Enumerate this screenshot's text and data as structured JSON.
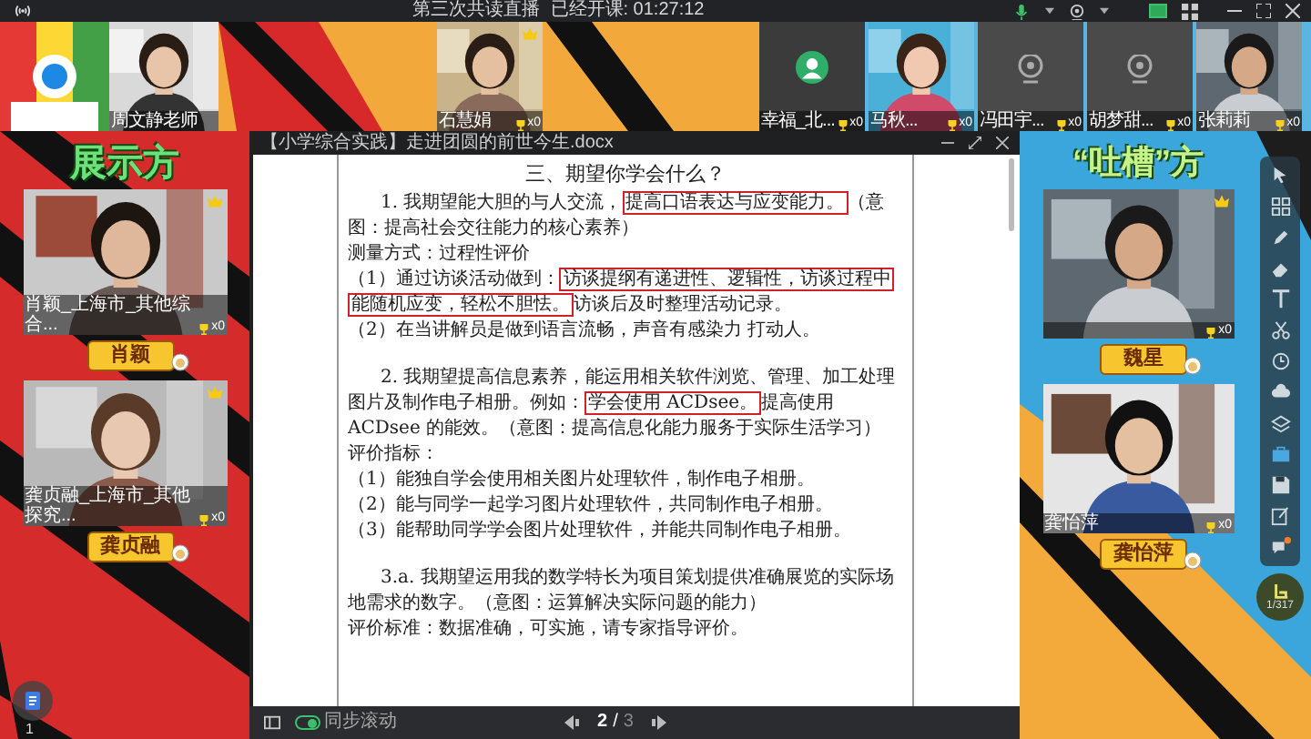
{
  "title_bar": {
    "title": "第三次共读直播",
    "elapsed": "已经开课: 01:27:12"
  },
  "top_strip": [
    {
      "kind": "video",
      "name": "周文静老师",
      "crown": false
    },
    {
      "kind": "video",
      "name": "石慧娟",
      "count": "x0",
      "crown": true
    },
    {
      "kind": "avatar",
      "name": "幸福_北...",
      "count": "x0",
      "crown": false
    },
    {
      "kind": "video",
      "name": "马秋...",
      "count": "x0",
      "crown": false
    },
    {
      "kind": "camera_off",
      "name": "冯田宇...",
      "count": "x0",
      "crown": false
    },
    {
      "kind": "camera_off",
      "name": "胡梦甜...",
      "count": "x0",
      "crown": false
    },
    {
      "kind": "video",
      "name": "张莉莉",
      "count": "x0",
      "crown": false
    }
  ],
  "presenters": {
    "heading": "展示方",
    "members": [
      {
        "caption": "肖颖_上海市_其他综合...",
        "count": "x0",
        "crown": true,
        "nameplate": "肖颖"
      },
      {
        "caption": "龚贞融_上海市_其他探究...",
        "count": "x0",
        "crown": true,
        "nameplate": "龚贞融"
      }
    ]
  },
  "critics": {
    "heading": "“吐槽”方",
    "members": [
      {
        "count": "x0",
        "crown": true,
        "nameplate": "魏星"
      },
      {
        "caption": "龚怡萍",
        "count": "x0",
        "crown": false,
        "nameplate": "龚怡萍"
      }
    ]
  },
  "document": {
    "title": "【小学综合实践】走进团圆的前世今生.docx",
    "paragraphs": [
      {
        "kind": "heading",
        "segments": [
          {
            "text": "三、期望你学会什么？",
            "boxed": false
          }
        ]
      },
      {
        "kind": "indent",
        "segments": [
          {
            "text": "1. 我期望能大胆的与人交流，",
            "boxed": false
          },
          {
            "text": "提高口语表达与应变能力。",
            "boxed": true
          },
          {
            "text": "（意图：提高社会交往能力的核心素养）",
            "boxed": false
          }
        ]
      },
      {
        "kind": "body",
        "segments": [
          {
            "text": "测量方式：过程性评价",
            "boxed": false
          }
        ]
      },
      {
        "kind": "body",
        "segments": [
          {
            "text": "（1）通过访谈活动做到：",
            "boxed": false
          },
          {
            "text": "访谈提纲有递进性、逻辑性，访谈过程中能随机应变，轻松不胆怯。",
            "boxed": true
          },
          {
            "text": "访谈后及时整理活动记录。",
            "boxed": false
          }
        ]
      },
      {
        "kind": "body",
        "segments": [
          {
            "text": "（2）在当讲解员是做到语言流畅，声音有感染力 打动人。",
            "boxed": false
          }
        ]
      },
      {
        "kind": "blank"
      },
      {
        "kind": "indent",
        "segments": [
          {
            "text": "2. 我期望提高信息素养，能运用相关软件浏览、管理、加工处理图片及制作电子相册。例如：",
            "boxed": false
          },
          {
            "text": "学会使用 ACDsee。",
            "boxed": true
          },
          {
            "text": "提高使用 ACDsee 的能效。（意图：提高信息化能力服务于实际生活学习）",
            "boxed": false
          }
        ]
      },
      {
        "kind": "body",
        "segments": [
          {
            "text": "评价指标：",
            "boxed": false
          }
        ]
      },
      {
        "kind": "body",
        "segments": [
          {
            "text": "（1）能独自学会使用相关图片处理软件，制作电子相册。",
            "boxed": false
          }
        ]
      },
      {
        "kind": "body",
        "segments": [
          {
            "text": "（2）能与同学一起学习图片处理软件，共同制作电子相册。",
            "boxed": false
          }
        ]
      },
      {
        "kind": "body",
        "segments": [
          {
            "text": "（3）能帮助同学学会图片处理软件，并能共同制作电子相册。",
            "boxed": false
          }
        ]
      },
      {
        "kind": "blank"
      },
      {
        "kind": "indent",
        "segments": [
          {
            "text": "3.a. 我期望运用我的数学特长为项目策划提供准确展览的实际场地需求的数字。（意图：运算解决实际问题的能力）",
            "boxed": false
          }
        ]
      },
      {
        "kind": "body",
        "segments": [
          {
            "text": "评价标准：数据准确，可实施，请专家指导评价。",
            "boxed": false
          }
        ]
      }
    ]
  },
  "pager": {
    "sync_label": "同步滚动",
    "sync_on": true,
    "current": "2",
    "separator": "/",
    "total": "3"
  },
  "doc_app": {
    "badge": "1"
  },
  "hand_button": {
    "count": "1/317"
  }
}
